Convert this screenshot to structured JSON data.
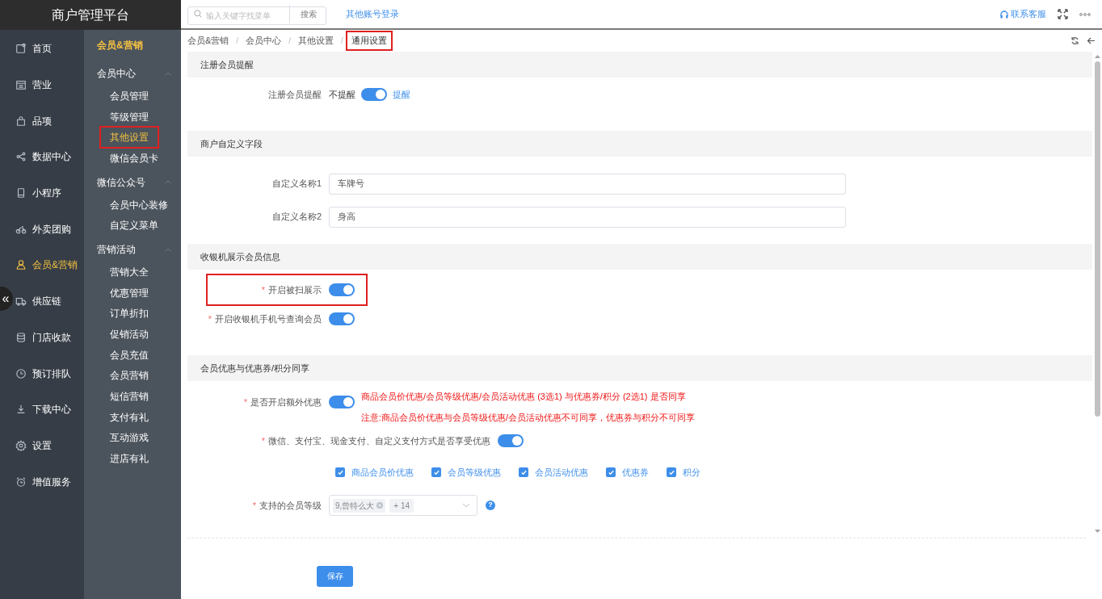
{
  "brand": "商户管理平台",
  "search": {
    "placeholder": "输入关键字找菜单",
    "button": "搜索"
  },
  "other_login": "其他账号登录",
  "service": "联系客服",
  "nav": [
    {
      "label": "首页",
      "selected": false
    },
    {
      "label": "营业",
      "selected": false
    },
    {
      "label": "品项",
      "selected": false
    },
    {
      "label": "数据中心",
      "selected": false
    },
    {
      "label": "小程序",
      "selected": false
    },
    {
      "label": "外卖团购",
      "selected": false
    },
    {
      "label": "会员&营销",
      "selected": true
    },
    {
      "label": "供应链",
      "selected": false
    },
    {
      "label": "门店收款",
      "selected": false
    },
    {
      "label": "预订排队",
      "selected": false
    },
    {
      "label": "下载中心",
      "selected": false
    },
    {
      "label": "设置",
      "selected": false
    },
    {
      "label": "增值服务",
      "selected": false
    }
  ],
  "collapse_glyph": "«",
  "submenu": {
    "title": "会员&营销",
    "groups": [
      {
        "label": "会员中心",
        "expanded": true,
        "items": [
          {
            "label": "会员管理",
            "selected": false,
            "highlighted": false
          },
          {
            "label": "等级管理",
            "selected": false,
            "highlighted": false
          },
          {
            "label": "其他设置",
            "selected": true,
            "highlighted": true
          },
          {
            "label": "微信会员卡",
            "selected": false,
            "highlighted": false
          }
        ]
      },
      {
        "label": "微信公众号",
        "expanded": true,
        "items": [
          {
            "label": "会员中心装修",
            "selected": false,
            "highlighted": false
          },
          {
            "label": "自定义菜单",
            "selected": false,
            "highlighted": false
          }
        ]
      },
      {
        "label": "营销活动",
        "expanded": true,
        "items": [
          {
            "label": "营销大全",
            "selected": false,
            "highlighted": false
          },
          {
            "label": "优惠管理",
            "selected": false,
            "highlighted": false
          },
          {
            "label": "订单折扣",
            "selected": false,
            "highlighted": false
          },
          {
            "label": "促销活动",
            "selected": false,
            "highlighted": false
          },
          {
            "label": "会员充值",
            "selected": false,
            "highlighted": false
          },
          {
            "label": "会员营销",
            "selected": false,
            "highlighted": false
          },
          {
            "label": "短信营销",
            "selected": false,
            "highlighted": false
          },
          {
            "label": "支付有礼",
            "selected": false,
            "highlighted": false
          },
          {
            "label": "互动游戏",
            "selected": false,
            "highlighted": false
          },
          {
            "label": "进店有礼",
            "selected": false,
            "highlighted": false
          }
        ]
      }
    ]
  },
  "breadcrumb": [
    {
      "label": "会员&营销",
      "highlighted": false
    },
    {
      "separator": "/",
      "label": "会员中心",
      "highlighted": false
    },
    {
      "separator": "/",
      "label": "其他设置",
      "highlighted": false
    },
    {
      "separator": "/",
      "label": "通用设置",
      "highlighted": true
    }
  ],
  "sections": [
    {
      "title": "注册会员提醒",
      "rows": [
        {
          "kind": "switch",
          "label": "注册会员提醒",
          "off_text": "不提醒",
          "on_text": "提醒",
          "on": true,
          "highlighted": false
        }
      ]
    },
    {
      "title": "商户自定义字段",
      "rows": [
        {
          "kind": "text",
          "label": "自定义名称1",
          "value": "车牌号"
        },
        {
          "kind": "text",
          "label": "自定义名称2",
          "value": "身高"
        }
      ]
    },
    {
      "title": "收银机展示会员信息",
      "rows": [
        {
          "kind": "switch",
          "label": "开启被扫展示",
          "required_mark": "*",
          "on": true,
          "highlighted": true
        },
        {
          "kind": "switch",
          "label": "开启收银机手机号查询会员",
          "required_mark": "*",
          "on": true,
          "highlighted": false
        }
      ]
    },
    {
      "title": "会员优惠与优惠券/积分同享",
      "rows": [
        {
          "kind": "switch",
          "label": "是否开启额外优惠",
          "required_mark": "*",
          "on": true,
          "highlighted": false,
          "notes": [
            "商品会员价优惠/会员等级优惠/会员活动优惠 (3选1) 与优惠券/积分 (2选1) 是否同享",
            "注意:商品会员价优惠与会员等级优惠/会员活动优惠不可同享，优惠券与积分不可同享"
          ]
        },
        {
          "kind": "switch_wide",
          "label": "微信、支付宝、现金支付、自定义支付方式是否享受优惠",
          "required_mark": "*",
          "on": true
        },
        {
          "kind": "checkboxes",
          "items": [
            {
              "label": "商品会员价优惠",
              "checked": true
            },
            {
              "label": "会员等级优惠",
              "checked": true
            },
            {
              "label": "会员活动优惠",
              "checked": true
            },
            {
              "label": "优惠券",
              "checked": true
            },
            {
              "label": "积分",
              "checked": true
            }
          ]
        },
        {
          "kind": "multiselect",
          "label": "支持的会员等级",
          "required_mark": "*",
          "tags": [
            "9,曾特么大"
          ],
          "more": "+ 14",
          "help": "?"
        }
      ]
    }
  ],
  "save": "保存"
}
